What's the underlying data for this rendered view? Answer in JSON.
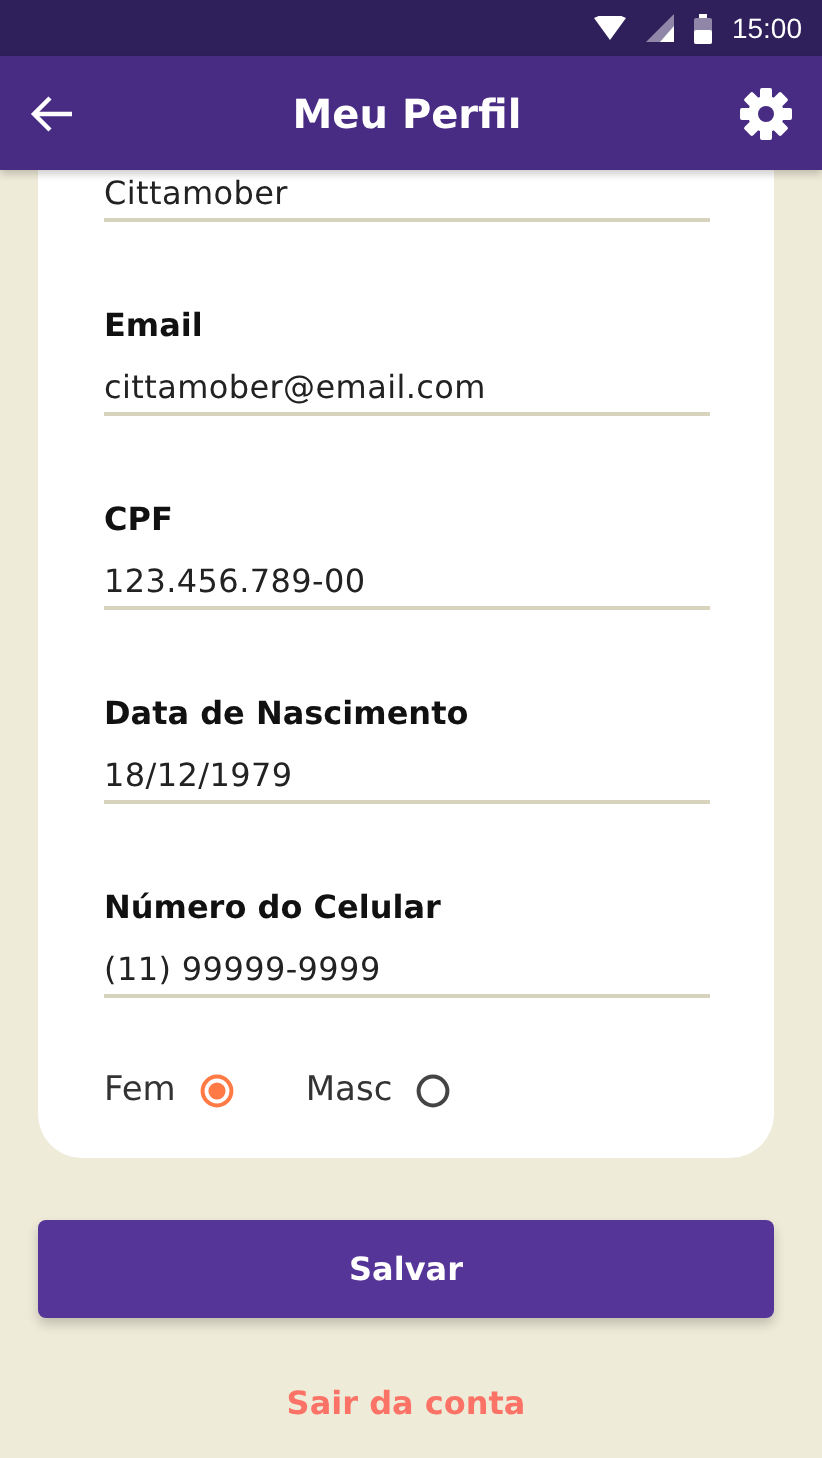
{
  "status_bar": {
    "time": "15:00"
  },
  "app_bar": {
    "title": "Meu Perfil"
  },
  "fields": [
    {
      "value": "Cittamober"
    },
    {
      "label": "Email",
      "value": "cittamober@email.com"
    },
    {
      "label": "CPF",
      "value": "123.456.789-00"
    },
    {
      "label": "Data de Nascimento",
      "value": "18/12/1979"
    },
    {
      "label": "Número do Celular",
      "value": "(11) 99999-9999"
    }
  ],
  "gender": [
    {
      "label": "Fem",
      "selected": true
    },
    {
      "label": "Masc",
      "selected": false
    }
  ],
  "save_button": "Salvar",
  "logout_link": "Sair da conta"
}
